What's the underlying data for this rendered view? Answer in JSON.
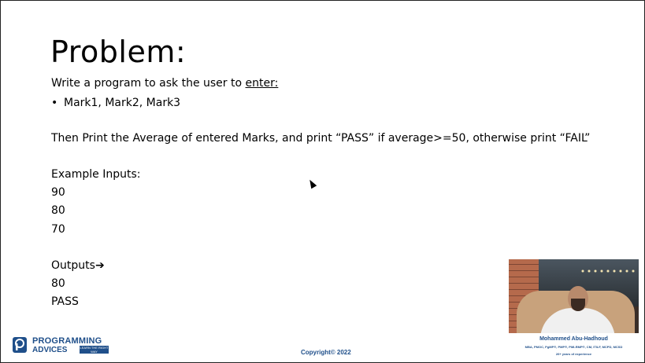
{
  "slide": {
    "title": "Problem:",
    "prompt_prefix": "Write a program to ask the user to ",
    "prompt_underlined": "enter:",
    "bullet_symbol": "•",
    "bullet_item": "Mark1, Mark2, Mark3",
    "instruction": "Then Print the Average of entered Marks, and print “PASS” if average>=50, otherwise print “FAIL”",
    "example_label": "Example Inputs:",
    "inputs": [
      "90",
      "80",
      "70"
    ],
    "outputs_label": "Outputs",
    "outputs_arrow": "➔",
    "outputs": [
      "80",
      "PASS"
    ]
  },
  "branding": {
    "logo_line1": "PROGRAMMING",
    "logo_line2": "ADVICES",
    "logo_tag": "LEARN THE RIGHT WAY",
    "logo_icon": "programming-advices-logo-icon",
    "copyright": "Copyright© 2022",
    "brand_color": "#1f4f8a"
  },
  "presenter": {
    "name": "Mohammed Abu-Hadhoud",
    "credentials": "MBA, PMOC, PgMP®, PMP®, PMI-RMP®, CM, ITILF, MCPD, MCSD",
    "experience": "26+ years of experience"
  }
}
